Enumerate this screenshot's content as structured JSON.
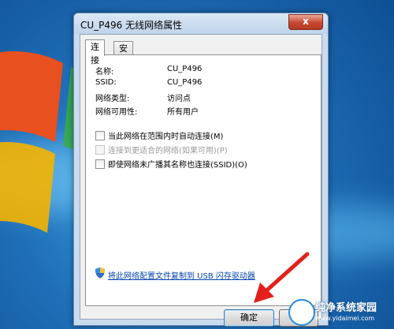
{
  "window": {
    "title": "CU_P496 无线网络属性",
    "close_glyph": "x"
  },
  "tabs": [
    {
      "label": "连接"
    },
    {
      "label": "安全"
    }
  ],
  "properties": [
    {
      "name": "名称:",
      "value": "CU_P496"
    },
    {
      "name": "SSID:",
      "value": "CU_P496"
    },
    {
      "name": "网络类型:",
      "value": "访问点"
    },
    {
      "name": "网络可用性:",
      "value": "所有用户"
    }
  ],
  "options": [
    {
      "label": "当此网络在范围内时自动连接(M)",
      "checked": false,
      "enabled": true
    },
    {
      "label": "连接到更适合的网络(如果可用)(P)",
      "checked": false,
      "enabled": false
    },
    {
      "label": "即使网络未广播其名称也连接(SSID)(O)",
      "checked": false,
      "enabled": true
    }
  ],
  "usb_link": "将此网络配置文件复制到 USB 闪存驱动器",
  "buttons": {
    "ok": "确定"
  },
  "watermark": {
    "title": "纯净系统家园",
    "url": "www.yidaimei.com"
  },
  "colors": {
    "accent": "#2b8ad6",
    "arrow": "#e3201b",
    "link": "#0645ad"
  }
}
